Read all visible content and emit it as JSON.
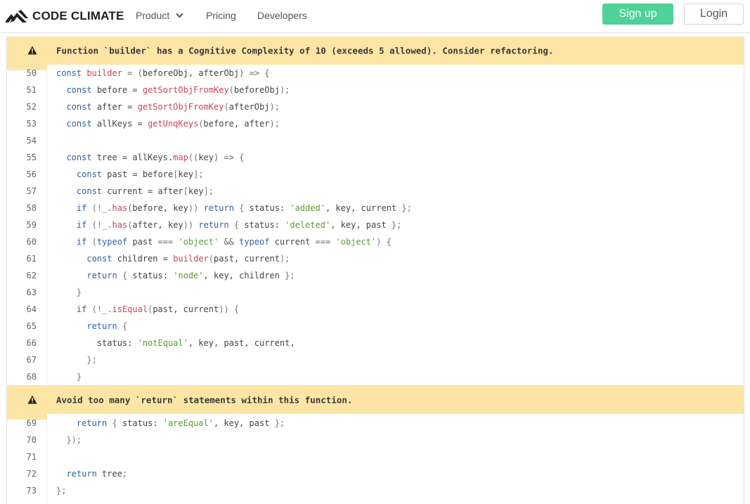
{
  "nav": {
    "logo_text": "CODE CLIMATE",
    "items": [
      {
        "label": "Product",
        "has_dropdown": true
      },
      {
        "label": "Pricing"
      },
      {
        "label": "Developers"
      }
    ],
    "signup_label": "Sign up",
    "login_label": "Login"
  },
  "colors": {
    "signup_bg": "#4fd197",
    "issue_bg": "#fde5a5",
    "keyword": "#2f5f9e",
    "function": "#c6455b",
    "string": "#5a9a36"
  },
  "issues": [
    {
      "icon": "warning-icon",
      "message": "Function `builder` has a Cognitive Complexity of 10 (exceeds 5 allowed). Consider refactoring."
    },
    {
      "icon": "warning-icon",
      "message": "Avoid too many `return` statements within this function."
    }
  ],
  "code_block_1": [
    {
      "n": "50",
      "tokens": [
        [
          "kw",
          "const "
        ],
        [
          "fn",
          "builder"
        ],
        [
          "op",
          " = ("
        ],
        [
          "",
          "beforeObj, afterObj"
        ],
        [
          "op",
          ") => {"
        ]
      ]
    },
    {
      "n": "51",
      "tokens": [
        [
          "",
          "  "
        ],
        [
          "kw",
          "const "
        ],
        [
          "",
          "before = "
        ],
        [
          "fn",
          "getSortObjFromKey"
        ],
        [
          "pn",
          "("
        ],
        [
          "",
          "beforeObj"
        ],
        [
          "pn",
          ");"
        ]
      ]
    },
    {
      "n": "52",
      "tokens": [
        [
          "",
          "  "
        ],
        [
          "kw",
          "const "
        ],
        [
          "",
          "after = "
        ],
        [
          "fn",
          "getSortObjFromKey"
        ],
        [
          "pn",
          "("
        ],
        [
          "",
          "afterObj"
        ],
        [
          "pn",
          ");"
        ]
      ]
    },
    {
      "n": "53",
      "tokens": [
        [
          "",
          "  "
        ],
        [
          "kw",
          "const "
        ],
        [
          "",
          "allKeys = "
        ],
        [
          "fn",
          "getUnqKeys"
        ],
        [
          "pn",
          "("
        ],
        [
          "",
          "before, after"
        ],
        [
          "pn",
          ");"
        ]
      ]
    },
    {
      "n": "54",
      "tokens": [
        [
          "",
          ""
        ]
      ]
    },
    {
      "n": "55",
      "tokens": [
        [
          "",
          "  "
        ],
        [
          "kw",
          "const "
        ],
        [
          "",
          "tree = allKeys."
        ],
        [
          "fn",
          "map"
        ],
        [
          "pn",
          "(("
        ],
        [
          "",
          "key"
        ],
        [
          "op",
          ") => {"
        ]
      ]
    },
    {
      "n": "56",
      "tokens": [
        [
          "",
          "    "
        ],
        [
          "kw",
          "const "
        ],
        [
          "",
          "past = before"
        ],
        [
          "pn",
          "["
        ],
        [
          "",
          "key"
        ],
        [
          "pn",
          "];"
        ]
      ]
    },
    {
      "n": "57",
      "tokens": [
        [
          "",
          "    "
        ],
        [
          "kw",
          "const "
        ],
        [
          "",
          "current = after"
        ],
        [
          "pn",
          "["
        ],
        [
          "",
          "key"
        ],
        [
          "pn",
          "];"
        ]
      ]
    },
    {
      "n": "58",
      "tokens": [
        [
          "",
          "    "
        ],
        [
          "kw",
          "if "
        ],
        [
          "pn",
          "(!_."
        ],
        [
          "fn",
          "has"
        ],
        [
          "pn",
          "("
        ],
        [
          "",
          "before, key"
        ],
        [
          "pn",
          "))"
        ],
        [
          "kw",
          " return "
        ],
        [
          "pn",
          "{ "
        ],
        [
          "",
          "status: "
        ],
        [
          "str",
          "'added'"
        ],
        [
          "",
          ", key, current "
        ],
        [
          "pn",
          "};"
        ]
      ]
    },
    {
      "n": "59",
      "tokens": [
        [
          "",
          "    "
        ],
        [
          "kw",
          "if "
        ],
        [
          "pn",
          "(!_."
        ],
        [
          "fn",
          "has"
        ],
        [
          "pn",
          "("
        ],
        [
          "",
          "after, key"
        ],
        [
          "pn",
          "))"
        ],
        [
          "kw",
          " return "
        ],
        [
          "pn",
          "{ "
        ],
        [
          "",
          "status: "
        ],
        [
          "str",
          "'deleted'"
        ],
        [
          "",
          ", key, past "
        ],
        [
          "pn",
          "};"
        ]
      ]
    },
    {
      "n": "60",
      "tokens": [
        [
          "",
          "    "
        ],
        [
          "kw",
          "if "
        ],
        [
          "pn",
          "("
        ],
        [
          "kw",
          "typeof "
        ],
        [
          "",
          "past "
        ],
        [
          "op",
          "=== "
        ],
        [
          "str",
          "'object'"
        ],
        [
          "op",
          " && "
        ],
        [
          "kw",
          "typeof "
        ],
        [
          "",
          "current "
        ],
        [
          "op",
          "=== "
        ],
        [
          "str",
          "'object'"
        ],
        [
          "pn",
          ") {"
        ]
      ]
    },
    {
      "n": "61",
      "tokens": [
        [
          "",
          "      "
        ],
        [
          "kw",
          "const "
        ],
        [
          "",
          "children = "
        ],
        [
          "fn",
          "builder"
        ],
        [
          "pn",
          "("
        ],
        [
          "",
          "past, current"
        ],
        [
          "pn",
          ");"
        ]
      ]
    },
    {
      "n": "62",
      "tokens": [
        [
          "",
          "      "
        ],
        [
          "kw",
          "return "
        ],
        [
          "pn",
          "{ "
        ],
        [
          "",
          "status: "
        ],
        [
          "str",
          "'node'"
        ],
        [
          "",
          ", key, children "
        ],
        [
          "pn",
          "};"
        ]
      ]
    },
    {
      "n": "63",
      "tokens": [
        [
          "",
          "    "
        ],
        [
          "pn",
          "}"
        ]
      ]
    },
    {
      "n": "64",
      "tokens": [
        [
          "",
          "    "
        ],
        [
          "kw",
          "if "
        ],
        [
          "pn",
          "(!_."
        ],
        [
          "fn",
          "isEqual"
        ],
        [
          "pn",
          "("
        ],
        [
          "",
          "past, current"
        ],
        [
          "pn",
          ")) {"
        ]
      ]
    },
    {
      "n": "65",
      "tokens": [
        [
          "",
          "      "
        ],
        [
          "kw",
          "return "
        ],
        [
          "pn",
          "{"
        ]
      ]
    },
    {
      "n": "66",
      "tokens": [
        [
          "",
          "        status: "
        ],
        [
          "str",
          "'notEqual'"
        ],
        [
          "",
          ", key, past, current,"
        ]
      ]
    },
    {
      "n": "67",
      "tokens": [
        [
          "",
          "      "
        ],
        [
          "pn",
          "};"
        ]
      ]
    },
    {
      "n": "68",
      "tokens": [
        [
          "",
          "    "
        ],
        [
          "pn",
          "}"
        ]
      ]
    }
  ],
  "code_block_2": [
    {
      "n": "69",
      "tokens": [
        [
          "",
          "    "
        ],
        [
          "kw",
          "return "
        ],
        [
          "pn",
          "{ "
        ],
        [
          "",
          "status: "
        ],
        [
          "str",
          "'areEqual'"
        ],
        [
          "",
          ", key, past "
        ],
        [
          "pn",
          "};"
        ]
      ]
    },
    {
      "n": "70",
      "tokens": [
        [
          "",
          "  "
        ],
        [
          "pn",
          "});"
        ]
      ]
    },
    {
      "n": "71",
      "tokens": [
        [
          "",
          ""
        ]
      ]
    },
    {
      "n": "72",
      "tokens": [
        [
          "",
          "  "
        ],
        [
          "kw",
          "return "
        ],
        [
          "",
          "tree"
        ],
        [
          "pn",
          ";"
        ]
      ]
    },
    {
      "n": "73",
      "tokens": [
        [
          "pn",
          "};"
        ]
      ]
    }
  ]
}
